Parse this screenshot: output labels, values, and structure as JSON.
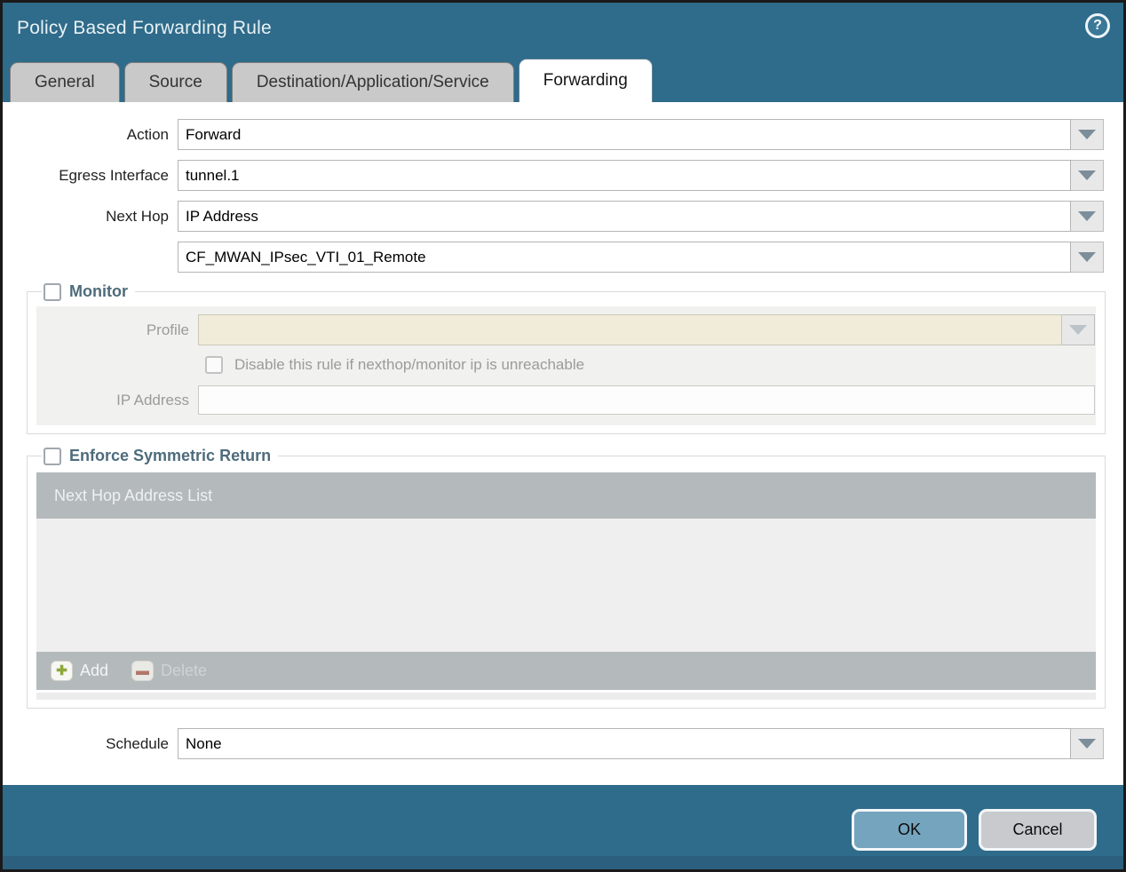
{
  "window": {
    "title": "Policy Based Forwarding Rule",
    "help_glyph": "?"
  },
  "tabs": [
    {
      "label": "General",
      "active": false
    },
    {
      "label": "Source",
      "active": false
    },
    {
      "label": "Destination/Application/Service",
      "active": false
    },
    {
      "label": "Forwarding",
      "active": true
    }
  ],
  "form": {
    "action": {
      "label": "Action",
      "value": "Forward"
    },
    "egress_interface": {
      "label": "Egress Interface",
      "value": "tunnel.1"
    },
    "next_hop": {
      "label": "Next Hop",
      "value": "IP Address"
    },
    "next_hop_address": {
      "value": "CF_MWAN_IPsec_VTI_01_Remote"
    },
    "monitor": {
      "legend": "Monitor",
      "checked": false,
      "profile": {
        "label": "Profile",
        "value": ""
      },
      "disable_rule": {
        "label": "Disable this rule if nexthop/monitor ip is unreachable",
        "checked": false
      },
      "ip_address": {
        "label": "IP Address",
        "value": ""
      }
    },
    "enforce_symmetric_return": {
      "legend": "Enforce Symmetric Return",
      "checked": false,
      "table_header": "Next Hop Address List",
      "rows": [],
      "add_label": "Add",
      "delete_label": "Delete",
      "add_icon_glyph": "✚",
      "delete_icon_glyph": "▬"
    },
    "schedule": {
      "label": "Schedule",
      "value": "None"
    }
  },
  "footer": {
    "ok_label": "OK",
    "cancel_label": "Cancel"
  },
  "colors": {
    "titlebar_teal": "#2f6b8a",
    "bottom_strip": "#2c5f7e",
    "tab_inactive": "#c9c9c9",
    "tab_active": "#ffffff",
    "section_legend_text": "#4e6b7b",
    "panel_gray": "#f1f1ef",
    "profile_field_beige": "#f1ecd9",
    "table_gray": "#b4b9bc",
    "table_body": "#efefef",
    "add_icon_green": "#8ea83b",
    "delete_icon_red": "#b1766b",
    "ok_button": "#75a4be",
    "cancel_button": "#c9cacd"
  }
}
